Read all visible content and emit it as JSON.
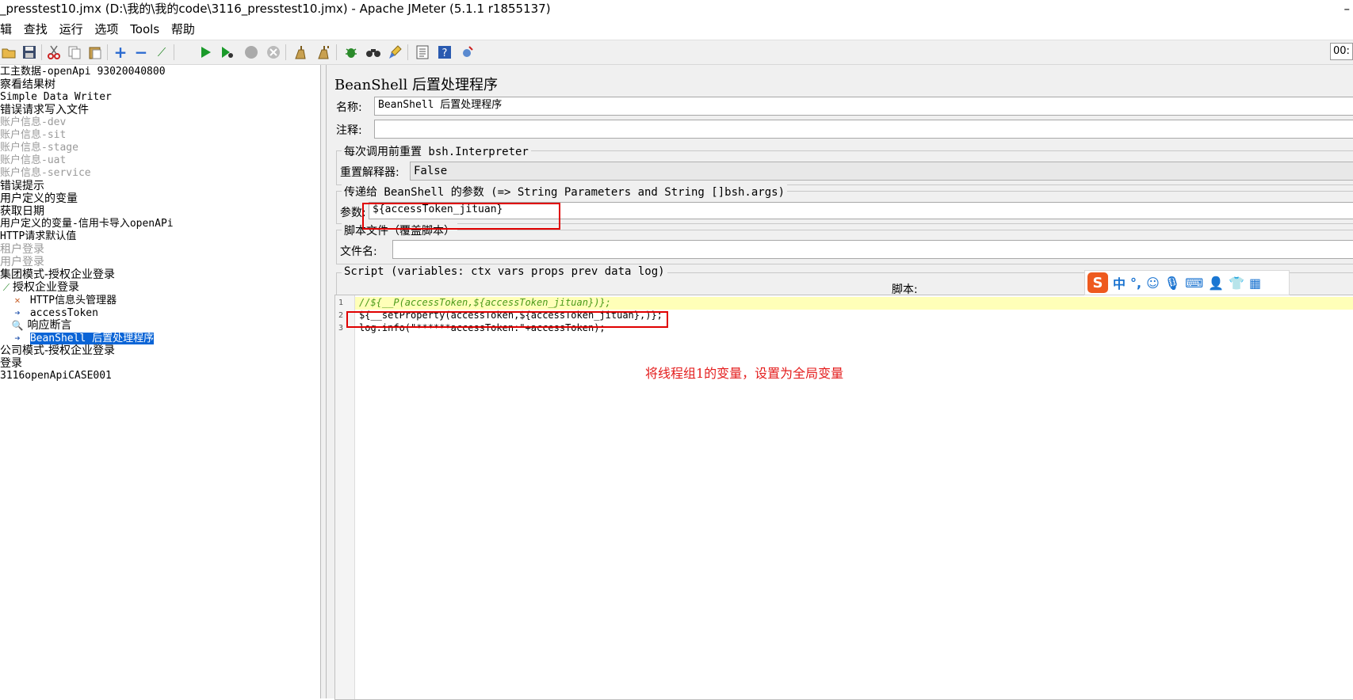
{
  "window": {
    "title": "_presstest10.jmx (D:\\我的\\我的code\\3116_presstest10.jmx) - Apache JMeter (5.1.1 r1855137)",
    "control": "–"
  },
  "menu": [
    "辑",
    "查找",
    "运行",
    "选项",
    "Tools",
    "帮助"
  ],
  "toolbar": {
    "icons": [
      "open-icon",
      "save-icon",
      "cut-icon",
      "copy-icon",
      "paste-icon",
      "expand-icon",
      "collapse-icon",
      "toggle-icon",
      "start-icon",
      "start-no-pause-icon",
      "stop-icon",
      "shutdown-icon",
      "clear-icon",
      "clear-all-icon",
      "function-helper-icon",
      "search-icon",
      "reset-search-icon",
      "templates-icon",
      "help-icon",
      "remote-icon"
    ],
    "timer": "00:"
  },
  "tree": {
    "items": [
      {
        "label": "工主数据-openApi  93020040800",
        "disabled": false
      },
      {
        "label": "察看结果树",
        "disabled": false
      },
      {
        "label": "Simple Data Writer",
        "disabled": false
      },
      {
        "label": "错误请求写入文件",
        "disabled": false
      },
      {
        "label": "账户信息-dev",
        "disabled": true
      },
      {
        "label": "账户信息-sit",
        "disabled": true
      },
      {
        "label": "账户信息-stage",
        "disabled": true
      },
      {
        "label": "账户信息-uat",
        "disabled": true
      },
      {
        "label": "账户信息-service",
        "disabled": true
      },
      {
        "label": "错误提示",
        "disabled": false
      },
      {
        "label": "用户定义的变量",
        "disabled": false
      },
      {
        "label": "获取日期",
        "disabled": false
      },
      {
        "label": "用户定义的变量-信用卡导入openAPi",
        "disabled": false
      },
      {
        "label": "HTTP请求默认值",
        "disabled": false
      },
      {
        "label": "租户登录",
        "disabled": true
      },
      {
        "label": "用户登录",
        "disabled": true
      },
      {
        "label": "集团模式-授权企业登录",
        "disabled": false
      },
      {
        "label": "授权企业登录",
        "disabled": false
      },
      {
        "label": "HTTP信息头管理器",
        "disabled": false
      },
      {
        "label": "accessToken",
        "disabled": false
      },
      {
        "label": "响应断言",
        "disabled": false
      },
      {
        "label": "BeanShell 后置处理程序",
        "disabled": false,
        "selected": true
      },
      {
        "label": "公司模式-授权企业登录",
        "disabled": false
      },
      {
        "label": "登录",
        "disabled": false
      },
      {
        "label": "3116openApiCASE001",
        "disabled": false
      }
    ]
  },
  "panel": {
    "heading": "BeanShell 后置处理程序",
    "name_label": "名称:",
    "name_value": "BeanShell 后置处理程序",
    "comment_label": "注释:",
    "comment_value": "",
    "reset_group_title": "每次调用前重置 bsh.Interpreter",
    "reset_label": "重置解释器:",
    "reset_value": "False",
    "params_group_title": "传递给 BeanShell 的参数 (=> String Parameters and String []bsh.args)",
    "params_label": "参数:",
    "params_value": "${accessToken_jituan}",
    "file_group_title": "脚本文件（覆盖脚本）",
    "file_label": "文件名:",
    "file_value": "",
    "script_group_title": "Script (variables: ctx vars props prev data log)",
    "script_label": "脚本:"
  },
  "script": {
    "lines": [
      {
        "no": "1",
        "text": "//${__P(accessToken,${accessToken_jituan})};"
      },
      {
        "no": "2",
        "text": "${__setProperty(accessToken,${accessToken_jituan},)};"
      },
      {
        "no": "3",
        "text": "log.info(\"******accessToken:\"+accessToken);"
      }
    ]
  },
  "annotation": "将线程组1的变量，设置为全局变量",
  "ime": {
    "logo": "S",
    "mode": "中",
    "punct": "°,",
    "buttons": [
      "emoji-icon",
      "mic-icon",
      "keyboard-icon",
      "user-icon",
      "skin-icon",
      "grid-icon"
    ]
  },
  "colors": {
    "annotation": "#e41e1e",
    "selection": "#0a64d6",
    "highlight": "#ffffb8",
    "comment": "#4a9a1a",
    "string": "#c2185b"
  }
}
